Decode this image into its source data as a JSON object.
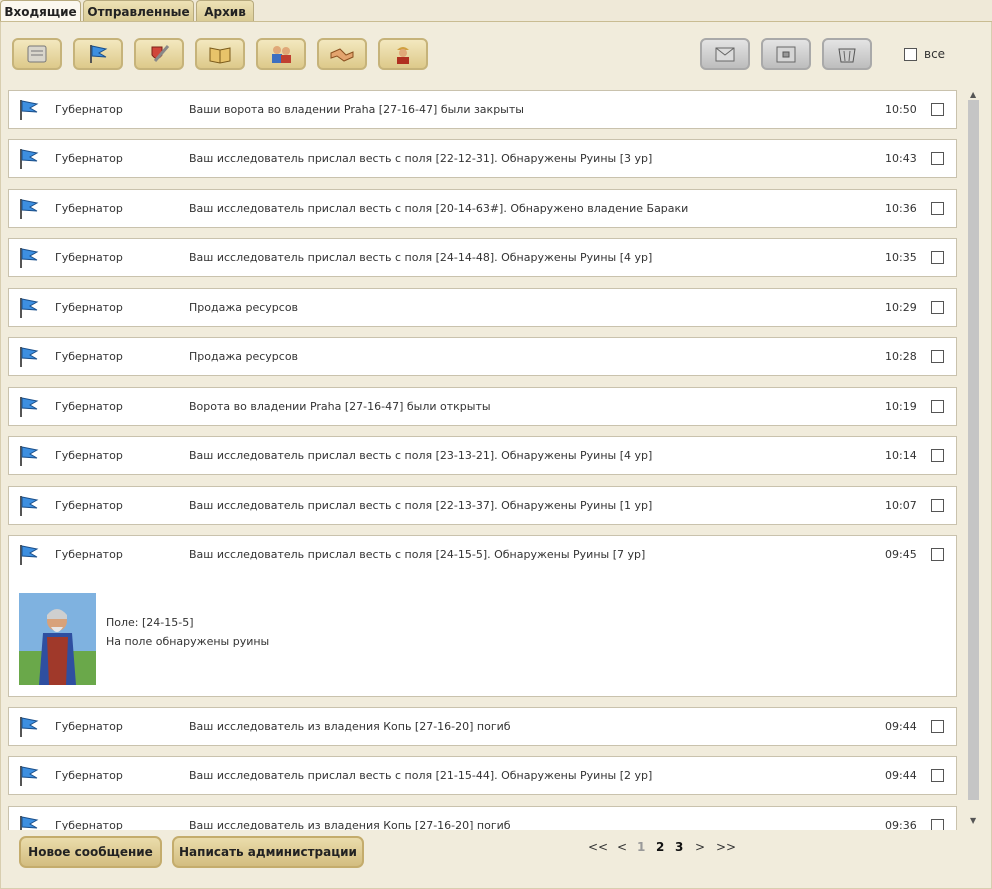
{
  "tabs": [
    {
      "label": "Входящие",
      "active": true
    },
    {
      "label": "Отправленные",
      "active": false
    },
    {
      "label": "Архив",
      "active": false
    }
  ],
  "toolbar": {
    "tools": [
      "scroll-icon",
      "flag-icon",
      "shield-sword-icon",
      "book-icon",
      "people-icon",
      "handshake-icon",
      "warrior-icon"
    ],
    "right_tools": [
      "envelope-icon",
      "archive-box-icon",
      "trash-basket-icon"
    ],
    "select_all_label": "все"
  },
  "messages": [
    {
      "from": "Губернатор",
      "subject": "Ваши ворота во владении Praha [27-16-47] были закрыты",
      "time": "10:50"
    },
    {
      "from": "Губернатор",
      "subject": "Ваш исследователь прислал весть с поля [22-12-31]. Обнаружены Руины [3 ур]",
      "time": "10:43"
    },
    {
      "from": "Губернатор",
      "subject": "Ваш исследователь прислал весть с поля [20-14-63#]. Обнаружено владение Бараки",
      "time": "10:36"
    },
    {
      "from": "Губернатор",
      "subject": "Ваш исследователь прислал весть с поля [24-14-48]. Обнаружены Руины [4 ур]",
      "time": "10:35"
    },
    {
      "from": "Губернатор",
      "subject": "Продажа ресурсов",
      "time": "10:29"
    },
    {
      "from": "Губернатор",
      "subject": "Продажа ресурсов",
      "time": "10:28"
    },
    {
      "from": "Губернатор",
      "subject": "Ворота во владении Praha [27-16-47] были открыты",
      "time": "10:19"
    },
    {
      "from": "Губернатор",
      "subject": "Ваш исследователь прислал весть с поля [23-13-21]. Обнаружены Руины [4 ур]",
      "time": "10:14"
    },
    {
      "from": "Губернатор",
      "subject": "Ваш исследователь прислал весть с поля [22-13-37]. Обнаружены Руины [1 ур]",
      "time": "10:07"
    },
    {
      "from": "Губернатор",
      "subject": "Ваш исследователь прислал весть с поля [24-15-5]. Обнаружены Руины [7 ур]",
      "time": "09:45",
      "expanded": true,
      "body_line1": "Поле: [24-15-5]",
      "body_line2": "На поле обнаружены руины"
    },
    {
      "from": "Губернатор",
      "subject": "Ваш исследователь из владения Копь [27-16-20] погиб",
      "time": "09:44"
    },
    {
      "from": "Губернатор",
      "subject": "Ваш исследователь прислал весть с поля [21-15-44]. Обнаружены Руины [2 ур]",
      "time": "09:44"
    },
    {
      "from": "Губернатор",
      "subject": "Ваш исследователь из владения Копь [27-16-20] погиб",
      "time": "09:36"
    }
  ],
  "buttons": {
    "new_message": "Новое сообщение",
    "write_admin": "Написать администрации"
  },
  "pager": {
    "first": "<<",
    "prev": "<",
    "pages": [
      "1",
      "2",
      "3"
    ],
    "current": "1",
    "next": ">",
    "last": ">>"
  },
  "colors": {
    "tab_active": "#fbf8ef",
    "button_gold": "#d3bd80",
    "flag_blue": "#3d8fe0"
  }
}
